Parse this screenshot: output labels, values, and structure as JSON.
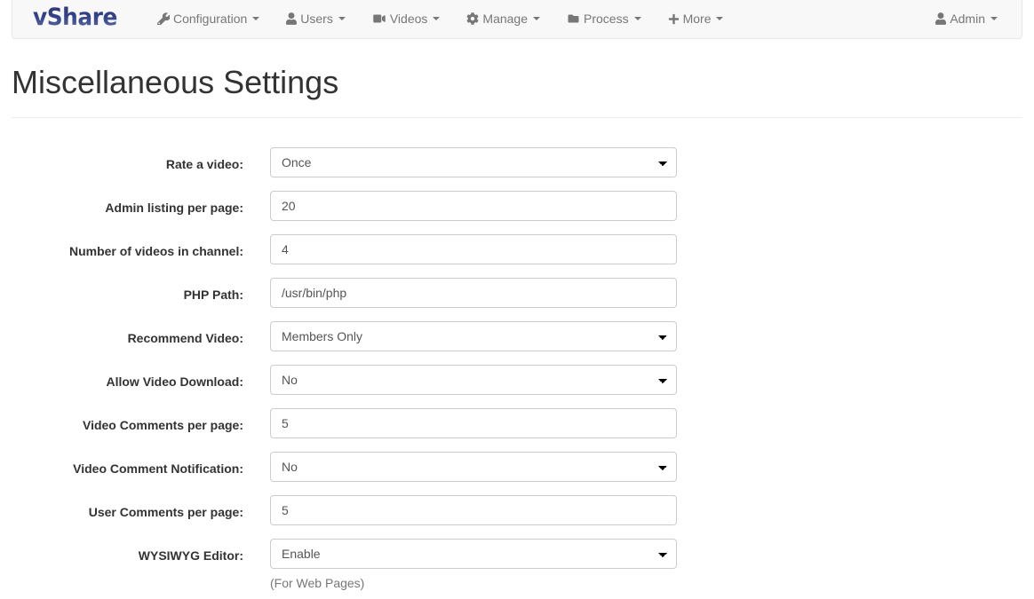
{
  "navbar": {
    "brand": "vShare",
    "items": [
      {
        "label": "Configuration",
        "icon": "wrench-icon",
        "caret": true
      },
      {
        "label": "Users",
        "icon": "user-icon",
        "caret": true
      },
      {
        "label": "Videos",
        "icon": "video-camera-icon",
        "caret": true
      },
      {
        "label": "Manage",
        "icon": "gear-icon",
        "caret": true
      },
      {
        "label": "Process",
        "icon": "folder-icon",
        "caret": true
      },
      {
        "label": "More",
        "icon": "plus-icon",
        "caret": true
      }
    ],
    "account": {
      "label": "Admin",
      "icon": "user-icon",
      "caret": true
    }
  },
  "page": {
    "title": "Miscellaneous Settings"
  },
  "form": {
    "rows": [
      {
        "label": "Rate a video:",
        "type": "select",
        "value": "Once"
      },
      {
        "label": "Admin listing per page:",
        "type": "text",
        "value": "20"
      },
      {
        "label": "Number of videos in channel:",
        "type": "text",
        "value": "4"
      },
      {
        "label": "PHP Path:",
        "type": "text",
        "value": "/usr/bin/php"
      },
      {
        "label": "Recommend Video:",
        "type": "select",
        "value": "Members Only"
      },
      {
        "label": "Allow Video Download:",
        "type": "select",
        "value": "No"
      },
      {
        "label": "Video Comments per page:",
        "type": "text",
        "value": "5"
      },
      {
        "label": "Video Comment Notification:",
        "type": "select",
        "value": "No"
      },
      {
        "label": "User Comments per page:",
        "type": "text",
        "value": "5"
      },
      {
        "label": "WYSIWYG Editor:",
        "type": "select",
        "value": "Enable",
        "help": "(For Web Pages)"
      }
    ]
  },
  "colors": {
    "brand": "#33418a",
    "navbar_bg": "#f8f8f8",
    "navbar_border": "#e7e7e7",
    "nav_link": "#777777",
    "text": "#333333",
    "input_border": "#cccccc",
    "input_text": "#555555",
    "help_text": "#777777"
  }
}
